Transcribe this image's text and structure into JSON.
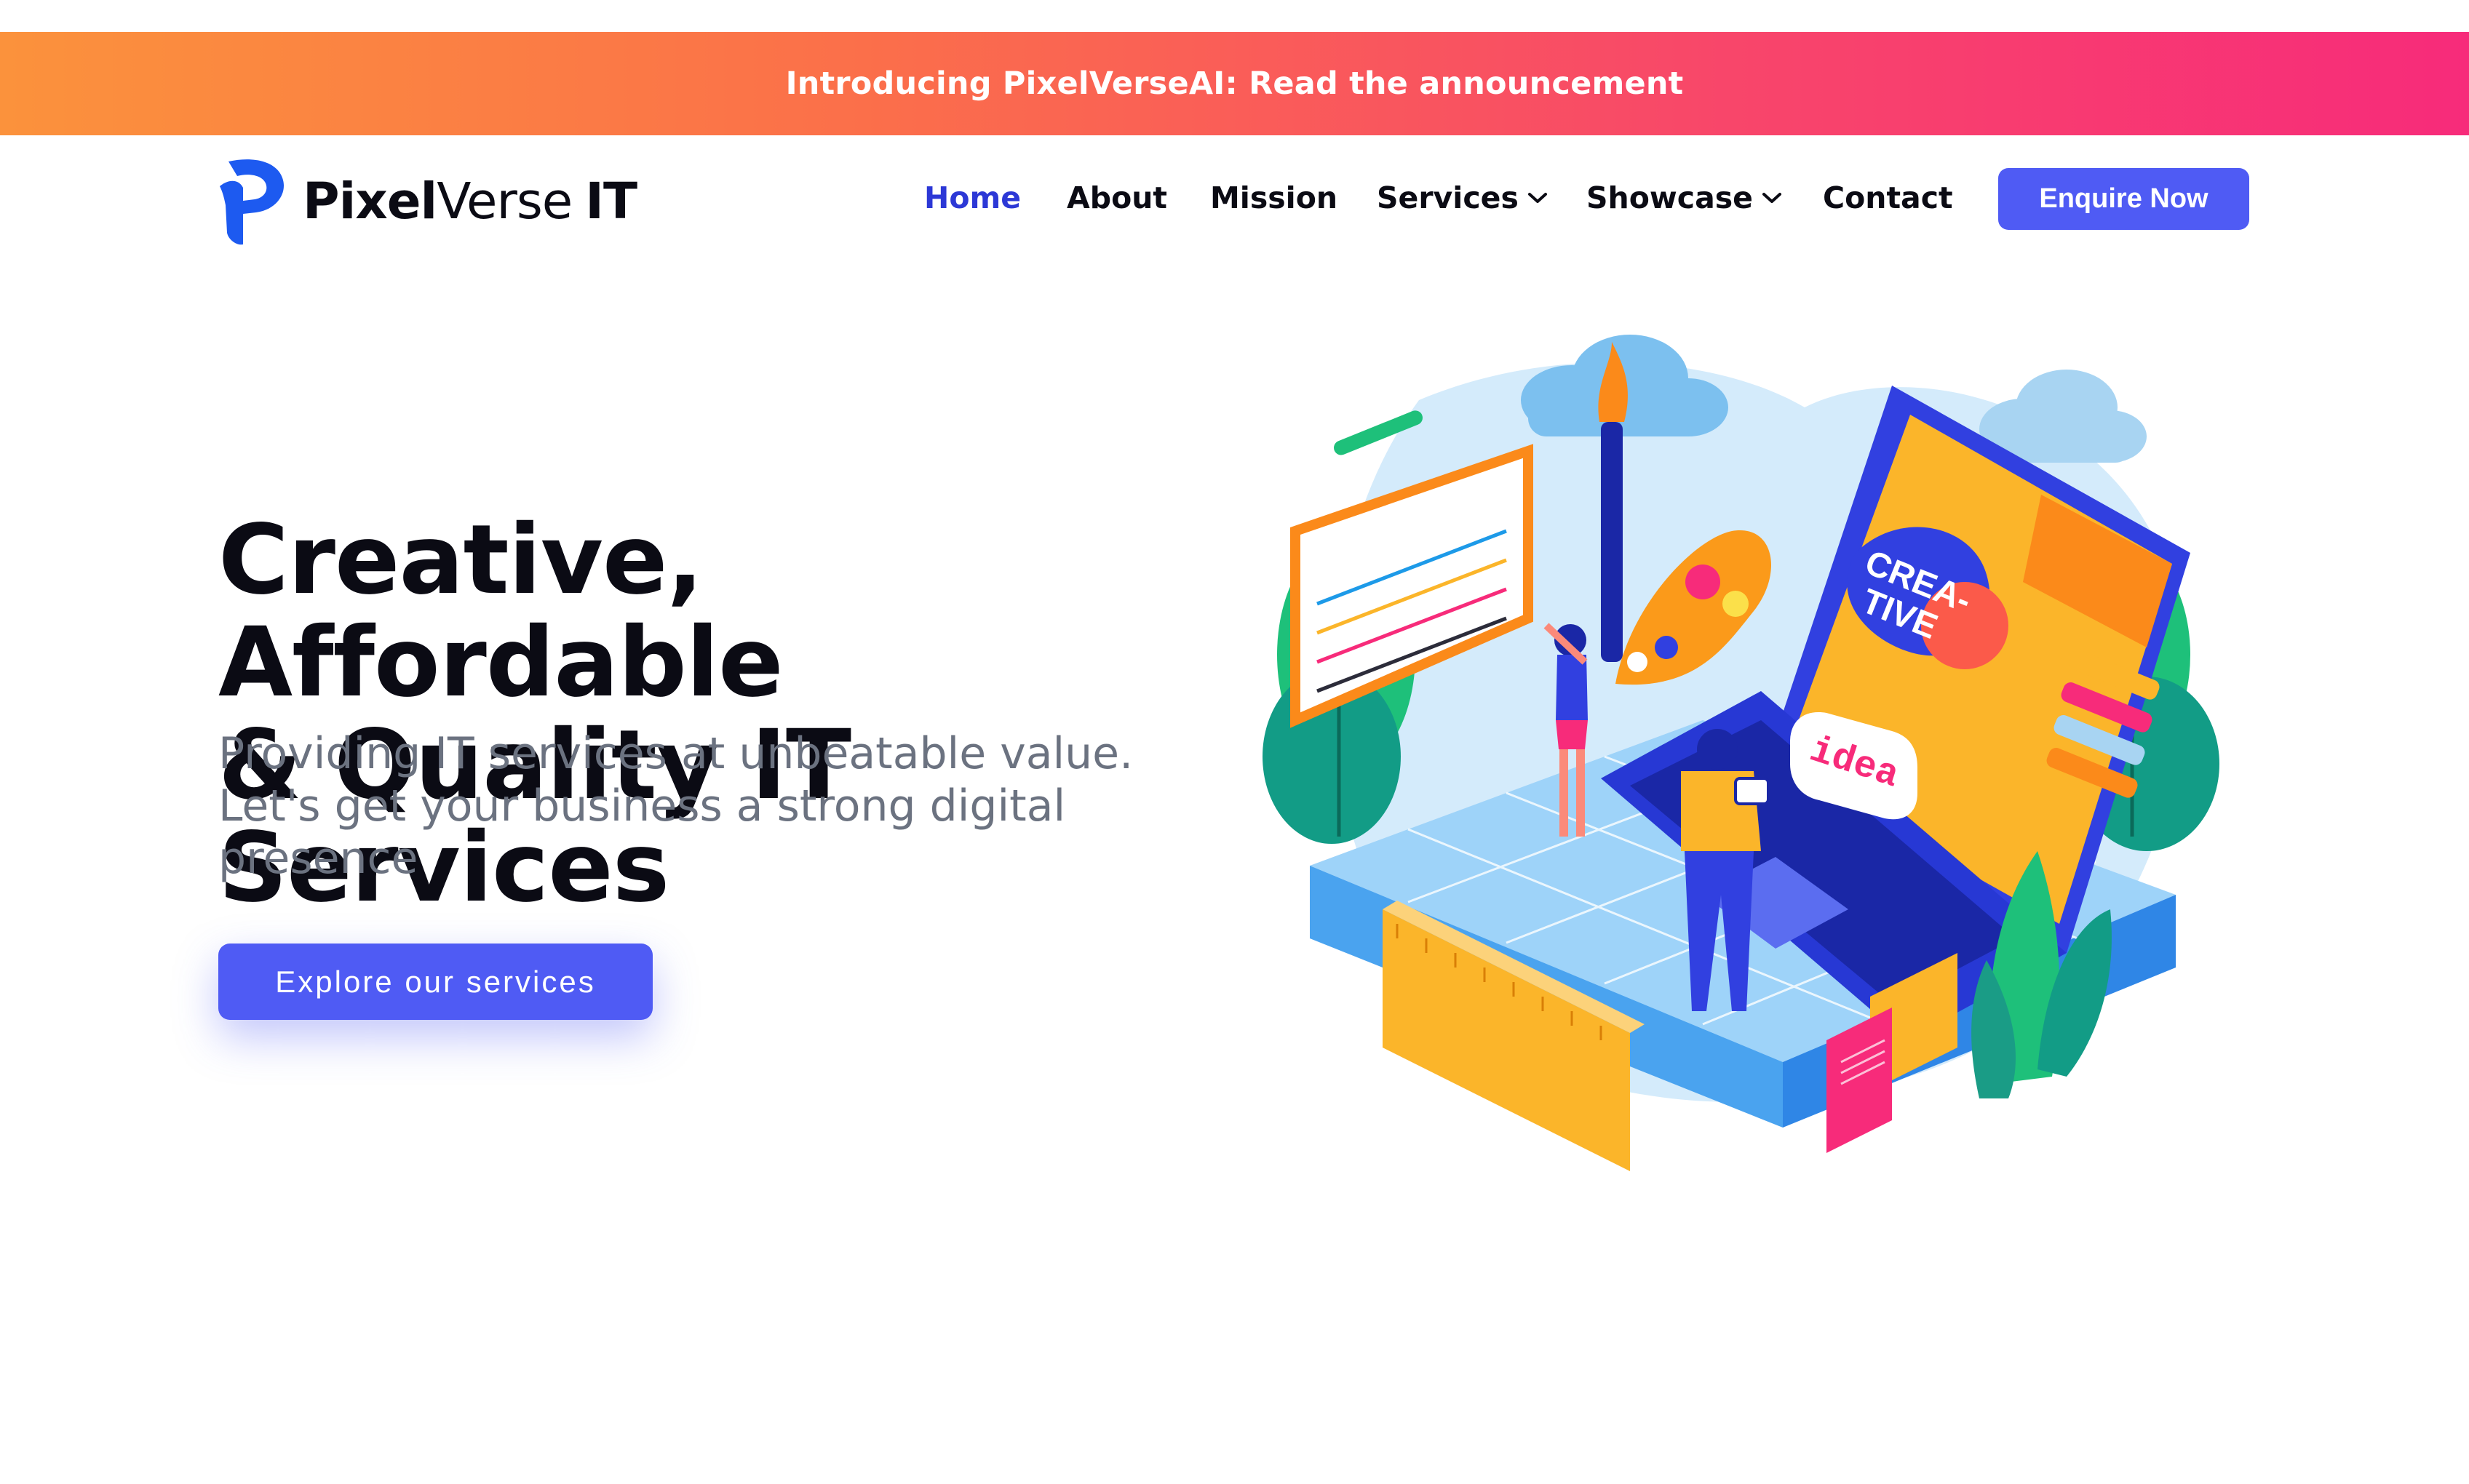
{
  "announcement": {
    "text": "Introducing PixelVerseAI: Read the announcement"
  },
  "brand": {
    "part1": "Pixel",
    "part2": "Verse",
    "part3": "IT",
    "icon": "pixelverse-p-logo"
  },
  "nav": {
    "items": [
      {
        "label": "Home",
        "active": true
      },
      {
        "label": "About"
      },
      {
        "label": "Mission"
      },
      {
        "label": "Services",
        "dropdown": true
      },
      {
        "label": "Showcase",
        "dropdown": true
      },
      {
        "label": "Contact"
      }
    ],
    "enquire_label": "Enquire Now"
  },
  "hero": {
    "title_line1": "Creative, Affordable",
    "title_line2": "& Quality IT Services",
    "subtitle": "Providing IT services at unbeatable value. Let's get your business a strong digital presence",
    "cta_label": "Explore our services"
  },
  "illustration": {
    "screen_word_line1": "CREA-",
    "screen_word_line2": "TIVE",
    "card_word": "idea"
  },
  "colors": {
    "accent": "#4f5bf4",
    "nav_active": "#2c38d6",
    "banner_start": "#fb923c",
    "banner_end": "#f72b7a",
    "subtitle": "#6b7280"
  }
}
